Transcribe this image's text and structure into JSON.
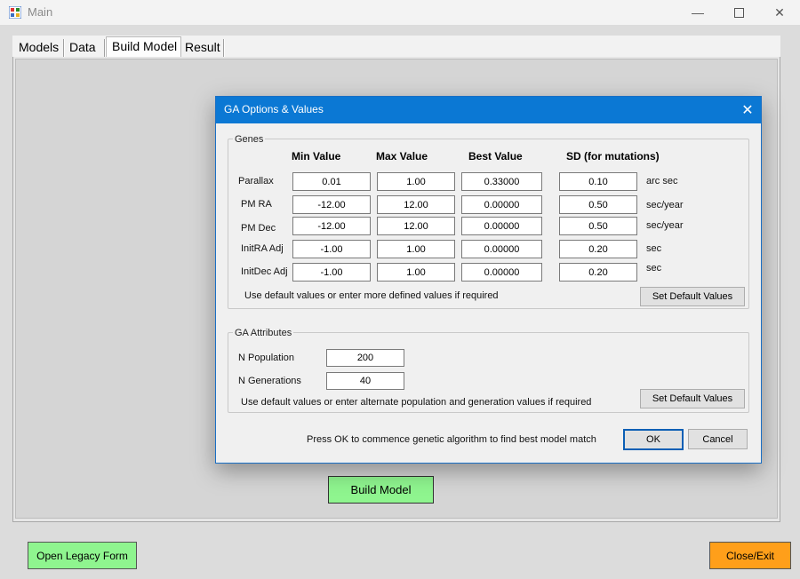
{
  "window": {
    "title": "Main"
  },
  "tabs": [
    "Models",
    "Data",
    "Build Model",
    "Result"
  ],
  "main": {
    "build_button": "Build Model",
    "legacy_button": "Open Legacy Form",
    "exit_button": "Close/Exit"
  },
  "dialog": {
    "title": "GA Options & Values",
    "genes": {
      "group_title": "Genes",
      "headers": [
        "Min Value",
        "Max Value",
        "Best Value",
        "SD (for mutations)"
      ],
      "rows": [
        {
          "label": "Parallax",
          "min": "0.01",
          "max": "1.00",
          "best": "0.33000",
          "sd": "0.10",
          "unit": "arc sec"
        },
        {
          "label": "PM RA",
          "min": "-12.00",
          "max": "12.00",
          "best": "0.00000",
          "sd": "0.50",
          "unit": "sec/year"
        },
        {
          "label": "PM Dec",
          "min": "-12.00",
          "max": "12.00",
          "best": "0.00000",
          "sd": "0.50",
          "unit": "sec/year"
        },
        {
          "label": "InitRA Adj",
          "min": "-1.00",
          "max": "1.00",
          "best": "0.00000",
          "sd": "0.20",
          "unit": "sec"
        },
        {
          "label": "InitDec Adj",
          "min": "-1.00",
          "max": "1.00",
          "best": "0.00000",
          "sd": "0.20",
          "unit": "sec"
        }
      ],
      "hint": "Use default values or enter more defined values if required",
      "default_button": "Set Default Values"
    },
    "attributes": {
      "group_title": "GA Attributes",
      "population_label": "N Population",
      "population": "200",
      "generations_label": "N Generations",
      "generations": "40",
      "hint": "Use default values or enter alternate population and generation values if required",
      "default_button": "Set Default Values"
    },
    "footer_text": "Press OK to commence genetic algorithm to find best model match",
    "ok": "OK",
    "cancel": "Cancel"
  },
  "colors": {
    "title_bar": "#0b78d4",
    "build_button": "#8ff58f",
    "exit_button": "#ff9f1a"
  }
}
